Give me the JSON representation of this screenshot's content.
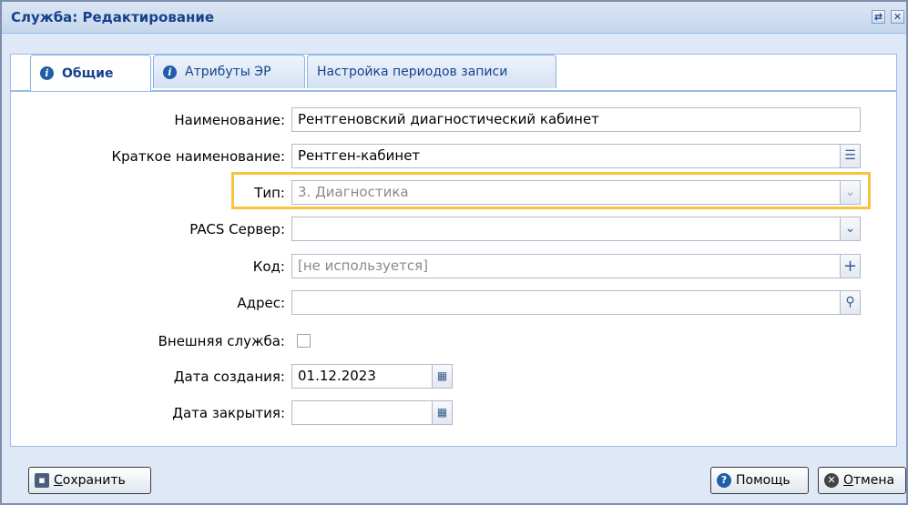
{
  "window": {
    "title": "Служба: Редактирование"
  },
  "tabs": [
    {
      "label": "Общие"
    },
    {
      "label": "Атрибуты ЭР"
    },
    {
      "label": "Настройка периодов записи"
    }
  ],
  "form": {
    "name": {
      "label": "Наименование:",
      "value": "Рентгеновский диагностический кабинет"
    },
    "short_name": {
      "label": "Краткое наименование:",
      "value": "Рентген-кабинет"
    },
    "type": {
      "label": "Тип:",
      "value": "3. Диагностика"
    },
    "pacs": {
      "label": "PACS Сервер:",
      "value": ""
    },
    "code": {
      "label": "Код:",
      "placeholder": "[не используется]"
    },
    "address": {
      "label": "Адрес:",
      "value": ""
    },
    "external": {
      "label": "Внешняя служба:",
      "checked": false
    },
    "created": {
      "label": "Дата создания:",
      "value": "01.12.2023"
    },
    "closed": {
      "label": "Дата закрытия:",
      "value": ""
    }
  },
  "buttons": {
    "save_first": "С",
    "save_rest": "охранить",
    "help": "Помощь",
    "cancel_first": "О",
    "cancel_rest": "тмена"
  },
  "colors": {
    "highlight": "#f6c43d",
    "title": "#15428b"
  }
}
